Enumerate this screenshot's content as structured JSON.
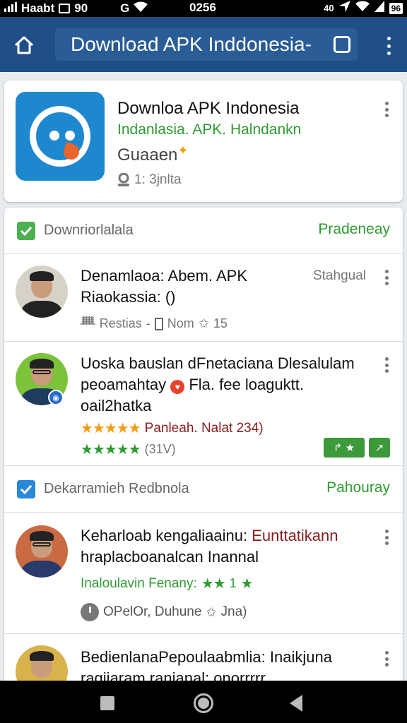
{
  "status_bar": {
    "left_text": "Haabt",
    "notif_text": "90",
    "carrier": "G",
    "time": "0256",
    "right_text": "40",
    "battery": "96"
  },
  "app_bar": {
    "title": "Download APK Inddonesia-",
    "home_icon": "home-icon",
    "menu_icon": "more-vert-icon"
  },
  "featured": {
    "title": "Downloa APK Indonesia",
    "subtitle": "Indanlasia. APK. Halndankn",
    "developer": "Guaaen",
    "meta": "1: 3jnlta"
  },
  "sections": [
    {
      "label": "Downriorlalala",
      "action": "Pradeneay",
      "checkbox_color": "#4caf50"
    },
    {
      "label": "Dekarramieh Redbnola",
      "action": "Pahouray",
      "checkbox_color": "#2a88d8"
    }
  ],
  "items": [
    {
      "line1": "Denamlaoa: Abem. APK",
      "line2": "Riaokassia: ()",
      "tag": "Stahgual",
      "meta_a": "Restias",
      "meta_b": "Nom",
      "meta_c": "15"
    },
    {
      "line1": "Uoska bauslan dFnetaciana Dlesalulam",
      "line2_a": "peoamahtay",
      "line2_b": "Fla. fee loaguktt.",
      "line3": "oail2hatka",
      "rating_text": "Panleah. Nalat 234)",
      "rating_count": "(31V)",
      "stars_orange": 4.5,
      "stars_green": 5
    },
    {
      "line1_a": "Keharloab kengaliaainu:",
      "line1_b": "Eunttatikann",
      "line2": "hraplacboanalcan Inannal",
      "line3": "Inaloulavin Fenany:",
      "line3_num": "1",
      "meta_a": "OPelOr, Duhune",
      "meta_b": "Jna)",
      "stars_green": 2.5
    },
    {
      "line1": "BedienlanaPepoulaabmlia: Inaikjuna",
      "line2": "ragiiaram ranianal: onorrrrr"
    }
  ],
  "colors": {
    "app_bar": "#1f4f86",
    "accent_green": "#2e9c32",
    "icon_blue": "#1e88cf"
  }
}
